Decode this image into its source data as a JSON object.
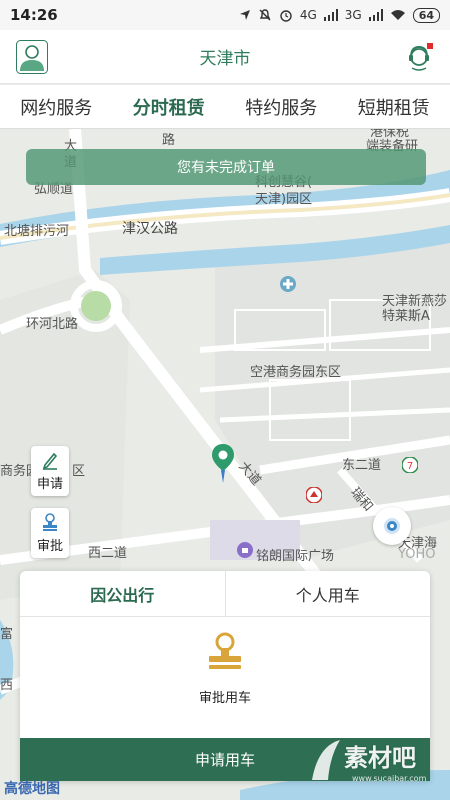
{
  "status_bar": {
    "time": "14:26",
    "signal_labels": [
      "4G",
      "3G"
    ],
    "battery": "64"
  },
  "header": {
    "city": "天津市"
  },
  "tabs": [
    {
      "label": "网约服务",
      "active": false
    },
    {
      "label": "分时租赁",
      "active": true
    },
    {
      "label": "特约服务",
      "active": false
    },
    {
      "label": "短期租赁",
      "active": false
    }
  ],
  "map": {
    "banner": "您有未完成订单",
    "labels": {
      "da_dao_top": "大",
      "dao_top": "道",
      "lu_top": "路",
      "hongshun": "弘顺道",
      "beitang": "北塘排污河",
      "jinhan": "津汉公路",
      "kechuang": "科创慧谷(",
      "tianjin_yuanqu": "天津)园区",
      "top_right_1": "港保税",
      "top_right_2": "端装备研",
      "huanhe": "环河北路",
      "konggang": "空港商务园东区",
      "xinyan_1": "天津新燕莎",
      "xinyan_2": "特莱斯A",
      "shangwu": "商务园",
      "qu": "区",
      "dadao_mid": "大道",
      "dong2": "东二道",
      "ruihe": "瑞和",
      "xi2": "西二道",
      "mingliang": "铭朗国际广场",
      "tianjinhai": "天津海",
      "yoho": "YOHO",
      "fu": "富",
      "xi": "西"
    },
    "side_buttons": {
      "apply": "申请",
      "approve": "审批"
    },
    "provider": "高德地图"
  },
  "panel": {
    "tabs": [
      {
        "label": "因公出行",
        "active": true
      },
      {
        "label": "个人用车",
        "active": false
      }
    ],
    "approve_label": "审批用车",
    "apply_button": "申请用车"
  },
  "watermark": {
    "brand": "素材吧",
    "url": "www.sucaibar.com"
  },
  "colors": {
    "brand_green": "#2e6e52",
    "accent_green": "#2f7d5e",
    "map_bg": "#e9ebe6",
    "water": "#a9d4ea"
  }
}
